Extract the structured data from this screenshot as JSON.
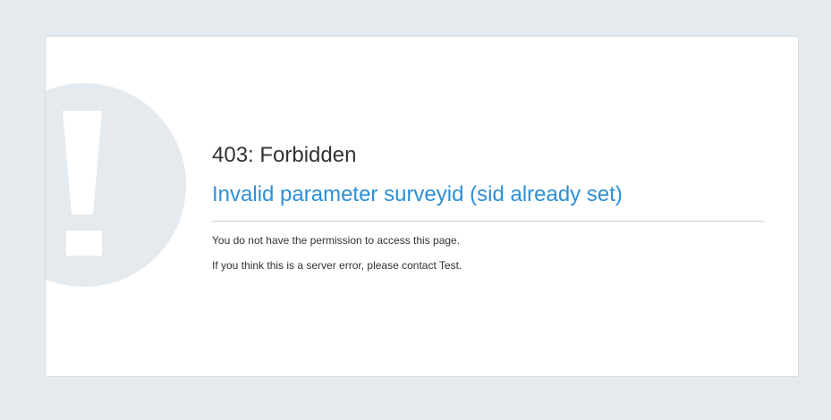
{
  "error": {
    "code_line": "403: Forbidden",
    "message": "Invalid parameter surveyid (sid already set)",
    "permission_text": "You do not have the permission to access this page.",
    "contact_text": "If you think this is a server error, please contact Test."
  },
  "icon": {
    "name": "exclamation-icon",
    "glyph_color": "#ffffff",
    "circle_color": "#e5eaef"
  },
  "colors": {
    "page_background": "#e5eaef",
    "card_background": "#ffffff",
    "message_color": "#2e8fd6",
    "text_color": "#333333"
  }
}
